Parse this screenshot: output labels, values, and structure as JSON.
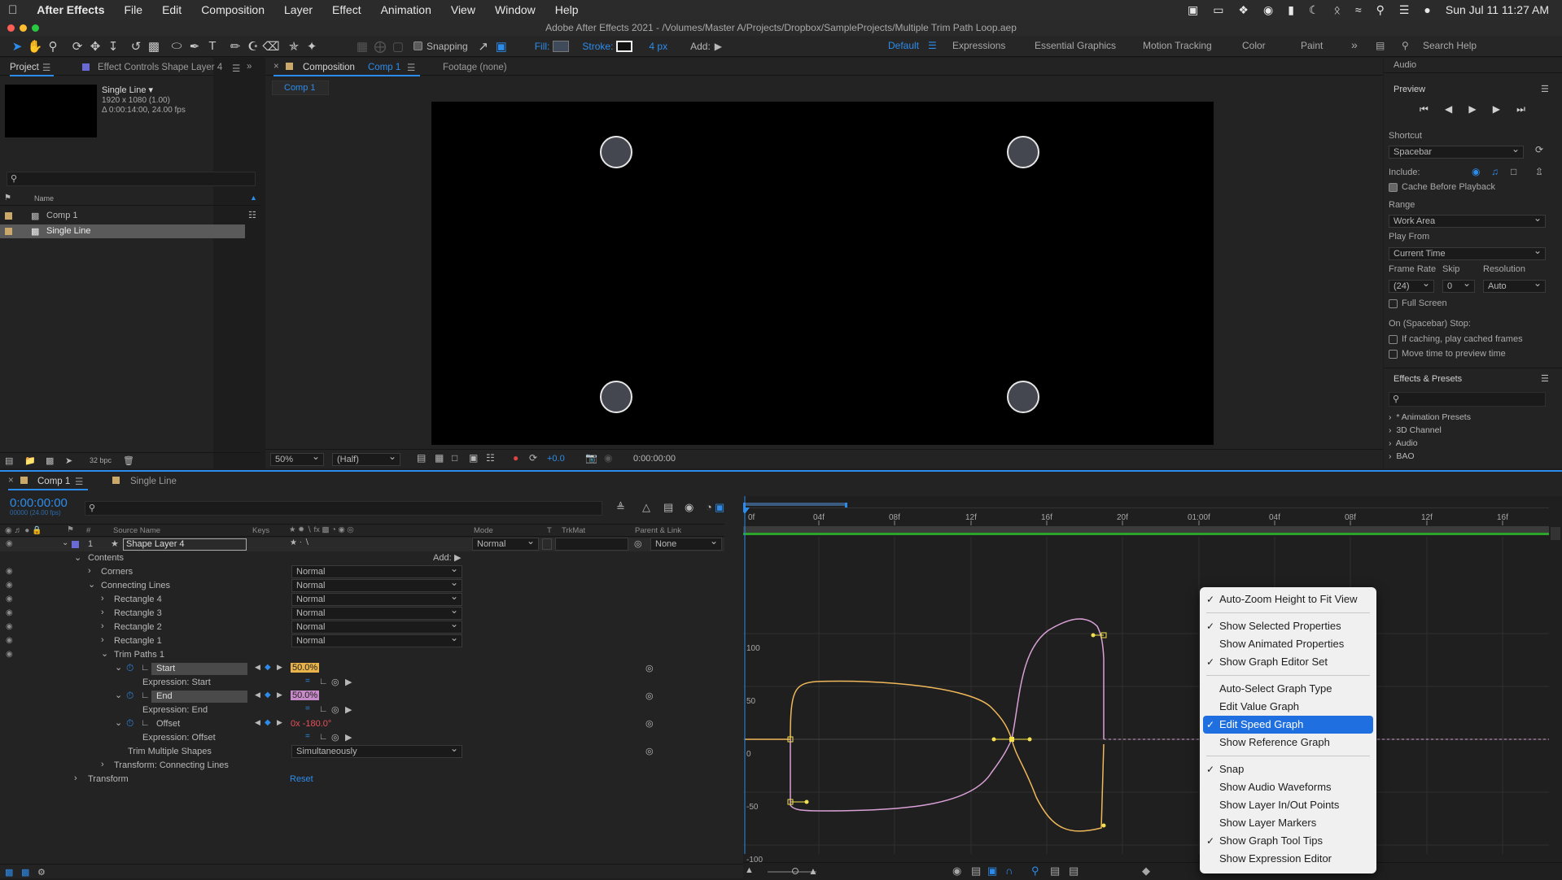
{
  "mac_menubar": {
    "app_name": "After Effects",
    "menus": [
      "File",
      "Edit",
      "Composition",
      "Layer",
      "Effect",
      "Animation",
      "View",
      "Window",
      "Help"
    ],
    "clock": "Sun Jul 11  11:27 AM"
  },
  "window_title": "Adobe After Effects 2021 - /Volumes/Master A/Projects/Dropbox/SampleProjects/Multiple Trim Path Loop.aep",
  "toolbar": {
    "snapping_label": "Snapping",
    "fill_label": "Fill:",
    "stroke_label": "Stroke:",
    "stroke_width": "4 px",
    "add_label": "Add:",
    "workspaces": [
      "Default",
      "Expressions",
      "Essential Graphics",
      "Motion Tracking",
      "Color",
      "Paint"
    ],
    "search_placeholder": "Search Help"
  },
  "project_panel": {
    "tab_project": "Project",
    "tab_effect_controls": "Effect Controls Shape Layer 4",
    "selected_name": "Single Line ▾",
    "selected_info_1": "1920 x 1080 (1.00)",
    "selected_info_2": "Δ 0:00:14:00, 24.00 fps",
    "col_name": "Name",
    "items": [
      "Comp 1",
      "Single Line"
    ],
    "bpc": "32 bpc"
  },
  "comp_panel": {
    "tab_label": "Composition",
    "tab_comp": "Comp 1",
    "footage_tab": "Footage (none)",
    "breadcrumb": "Comp 1",
    "zoom": "50%",
    "resolution": "(Half)",
    "exposure": "+0.0",
    "timecode": "0:00:00:00"
  },
  "right_panel": {
    "audio_title": "Audio",
    "preview_title": "Preview",
    "shortcut_label": "Shortcut",
    "shortcut_value": "Spacebar",
    "include_label": "Include:",
    "cache_label": "Cache Before Playback",
    "range_label": "Range",
    "range_value": "Work Area",
    "play_from_label": "Play From",
    "play_from_value": "Current Time",
    "frame_rate_label": "Frame Rate",
    "skip_label": "Skip",
    "resolution_label": "Resolution",
    "frame_rate_value": "(24)",
    "skip_value": "0",
    "resolution_value": "Auto",
    "full_screen_label": "Full Screen",
    "stop_label": "On (Spacebar) Stop:",
    "if_caching_label": "If caching, play cached frames",
    "move_time_label": "Move time to preview time",
    "effects_title": "Effects & Presets",
    "effects_items": [
      "* Animation Presets",
      "3D Channel",
      "Audio",
      "BAO"
    ]
  },
  "timeline": {
    "tab_comp": "Comp 1",
    "tab_single": "Single Line",
    "timecode": "0:00:00:00",
    "timecode_sub": "00000 (24.00 fps)",
    "col_source": "Source Name",
    "col_keys": "Keys",
    "col_mode": "Mode",
    "col_t": "T",
    "col_trkmat": "TrkMat",
    "col_parent": "Parent & Link",
    "layer_num": "1",
    "layer_name": "Shape Layer 4",
    "layer_mode": "Normal",
    "layer_parent": "None",
    "contents": "Contents",
    "add_label": "Add:",
    "props": [
      {
        "name": "Corners",
        "value": "Normal"
      },
      {
        "name": "Connecting Lines",
        "value": "Normal"
      },
      {
        "name": "Rectangle 4",
        "value": "Normal"
      },
      {
        "name": "Rectangle 3",
        "value": "Normal"
      },
      {
        "name": "Rectangle 2",
        "value": "Normal"
      },
      {
        "name": "Rectangle 1",
        "value": "Normal"
      }
    ],
    "trim_paths": "Trim Paths 1",
    "start_label": "Start",
    "start_value": "50.0%",
    "expr_start": "Expression: Start",
    "end_label": "End",
    "end_value": "50.0%",
    "expr_end": "Expression: End",
    "offset_label": "Offset",
    "offset_value": "0x -180.0°",
    "expr_offset": "Expression: Offset",
    "trim_multiple": "Trim Multiple Shapes",
    "trim_multiple_value": "Simultaneously",
    "transform_connecting": "Transform: Connecting Lines",
    "transform": "Transform",
    "reset": "Reset"
  },
  "ruler_ticks": [
    "0f",
    "04f",
    "08f",
    "12f",
    "16f",
    "20f",
    "01:00f",
    "04f",
    "08f",
    "12f",
    "16f"
  ],
  "graph_labels": [
    "100",
    "50",
    "0",
    "-50",
    "-100"
  ],
  "context_menu": {
    "items": [
      {
        "label": "Auto-Zoom Height to Fit View",
        "checked": true
      },
      {
        "sep": true
      },
      {
        "label": "Show Selected Properties",
        "checked": true
      },
      {
        "label": "Show Animated Properties",
        "checked": false
      },
      {
        "label": "Show Graph Editor Set",
        "checked": true
      },
      {
        "sep": true
      },
      {
        "label": "Auto-Select Graph Type",
        "checked": false
      },
      {
        "label": "Edit Value Graph",
        "checked": false
      },
      {
        "label": "Edit Speed Graph",
        "checked": true,
        "highlight": true
      },
      {
        "label": "Show Reference Graph",
        "checked": false
      },
      {
        "sep": true
      },
      {
        "label": "Snap",
        "checked": true
      },
      {
        "label": "Show Audio Waveforms",
        "checked": false
      },
      {
        "label": "Show Layer In/Out Points",
        "checked": false
      },
      {
        "label": "Show Layer Markers",
        "checked": false
      },
      {
        "label": "Show Graph Tool Tips",
        "checked": true
      },
      {
        "label": "Show Expression Editor",
        "checked": false
      }
    ]
  },
  "colors": {
    "accent_blue": "#2d8ceb",
    "graph_orange": "#f0b85a",
    "graph_pink": "#d9a0d6",
    "keyframe_yellow": "#f4e04d",
    "menu_highlight": "#1f6fe0"
  }
}
